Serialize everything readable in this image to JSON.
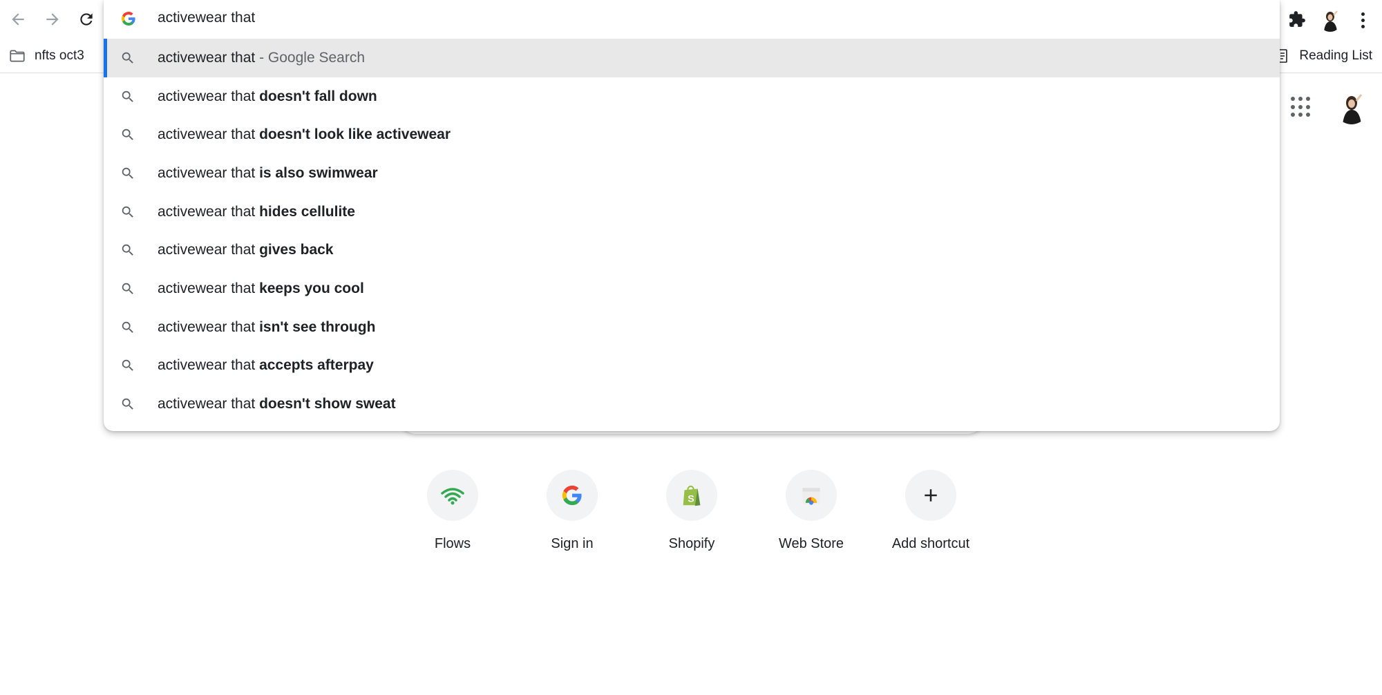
{
  "browser": {
    "back_icon": "arrow-left-icon",
    "forward_icon": "arrow-right-icon",
    "reload_icon": "reload-icon",
    "extensions_icon": "puzzle-icon",
    "menu_icon": "more-vert-icon"
  },
  "bookmarks": {
    "folder_label": "nfts oct3",
    "reading_list_label": "Reading List"
  },
  "omnibox": {
    "input_value": "activewear that",
    "accent_color": "#1a73e8",
    "suggestions": [
      {
        "base": "activewear that",
        "rest": "",
        "suffix": " - Google Search",
        "selected": true
      },
      {
        "base": "activewear that ",
        "rest": "doesn't fall down",
        "suffix": ""
      },
      {
        "base": "activewear that ",
        "rest": "doesn't look like activewear",
        "suffix": ""
      },
      {
        "base": "activewear that ",
        "rest": "is also swimwear",
        "suffix": ""
      },
      {
        "base": "activewear that ",
        "rest": "hides cellulite",
        "suffix": ""
      },
      {
        "base": "activewear that ",
        "rest": "gives back",
        "suffix": ""
      },
      {
        "base": "activewear that ",
        "rest": "keeps you cool",
        "suffix": ""
      },
      {
        "base": "activewear that ",
        "rest": "isn't see through",
        "suffix": ""
      },
      {
        "base": "activewear that ",
        "rest": "accepts afterpay",
        "suffix": ""
      },
      {
        "base": "activewear that ",
        "rest": "doesn't show sweat",
        "suffix": ""
      }
    ]
  },
  "shortcuts": [
    {
      "label": "Flows",
      "icon": "wifi-icon"
    },
    {
      "label": "Sign in",
      "icon": "google-g-icon"
    },
    {
      "label": "Shopify",
      "icon": "shopify-bag-icon"
    },
    {
      "label": "Web Store",
      "icon": "chrome-web-store-icon"
    },
    {
      "label": "Add shortcut",
      "icon": "plus-icon"
    }
  ]
}
